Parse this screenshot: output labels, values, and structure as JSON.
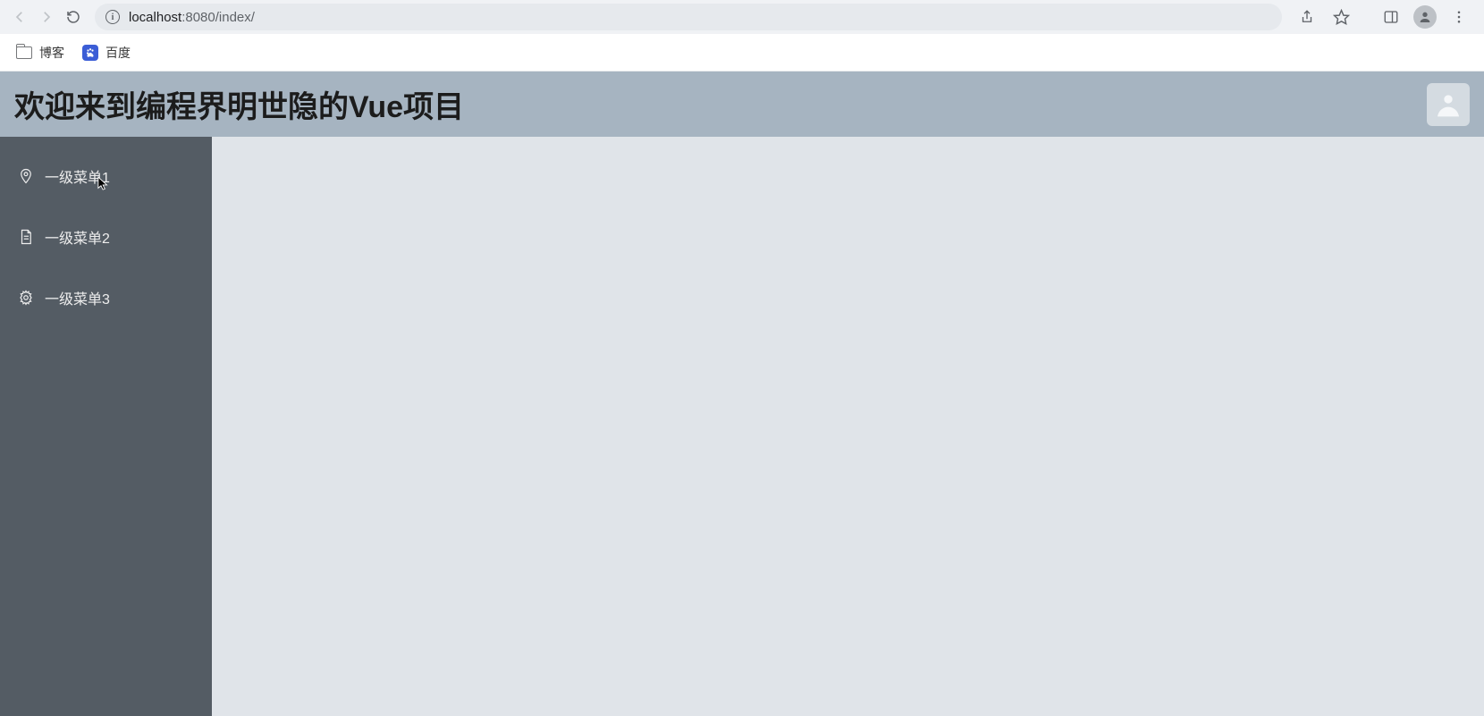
{
  "browser": {
    "url_host": "localhost",
    "url_port_path": ":8080/index/",
    "bookmarks": [
      {
        "label": "博客",
        "icon": "folder"
      },
      {
        "label": "百度",
        "icon": "baidu"
      }
    ]
  },
  "header": {
    "title": "欢迎来到编程界明世隐的Vue项目"
  },
  "sidebar": {
    "items": [
      {
        "label": "一级菜单1",
        "icon": "location"
      },
      {
        "label": "一级菜单2",
        "icon": "document"
      },
      {
        "label": "一级菜单3",
        "icon": "setting"
      }
    ]
  }
}
